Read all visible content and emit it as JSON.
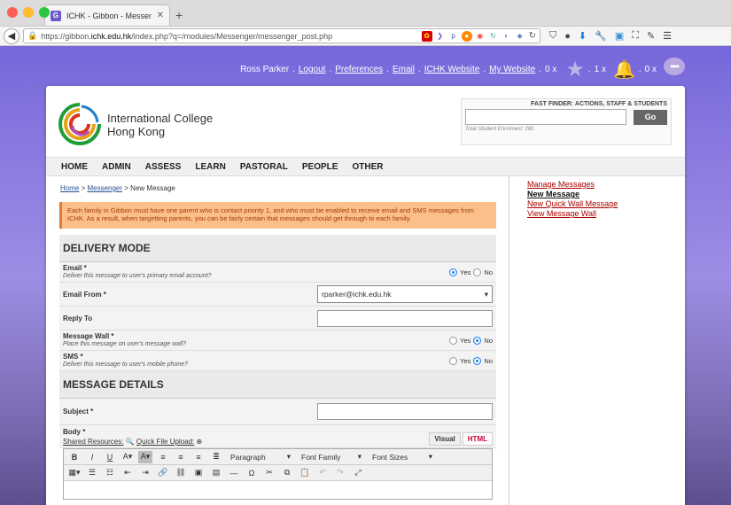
{
  "browser": {
    "tab_title": "ICHK - Gibbon - Messenger",
    "tab_favicon": "G",
    "url_prefix": "https://gibbon.",
    "url_domain": "ichk.edu.hk",
    "url_suffix": "/index.php?q=/modules/Messenger/messenger_post.php"
  },
  "toplinks": {
    "user": "Ross Parker",
    "logout": "Logout",
    "preferences": "Preferences",
    "email": "Email",
    "website": "ICHK Website",
    "my_website": "My Website",
    "likes_count": "0 x",
    "star_count": "1 x",
    "notif_count": "0 x"
  },
  "header": {
    "college_line1": "International College",
    "college_line2": "Hong Kong",
    "finder_title": "FAST FINDER: ACTIONS, STAFF & STUDENTS",
    "finder_button": "Go",
    "enrolment": "Total Student Enrolment: 280"
  },
  "menu": [
    "HOME",
    "ADMIN",
    "ASSESS",
    "LEARN",
    "PASTORAL",
    "PEOPLE",
    "OTHER"
  ],
  "breadcrumb": {
    "home": "Home",
    "messenger": "Messenger",
    "current": "New Message"
  },
  "warning": "Each family in Gibbon must have one parent who is contact priority 1, and who must be enabled to receive email and SMS messages from ICHK. As a result, when targetting parents, you can be fairly certain that messages should get through to each family.",
  "delivery": {
    "title": "DELIVERY MODE",
    "email_label": "Email *",
    "email_desc": "Deliver this message to user's primary email account?",
    "email_from_label": "Email From *",
    "email_from_value": "rparker@ichk.edu.hk",
    "reply_to_label": "Reply To",
    "wall_label": "Message Wall *",
    "wall_desc": "Place this message on user's message wall?",
    "sms_label": "SMS *",
    "sms_desc": "Deliver this message to user's mobile phone?",
    "yes": "Yes",
    "no": "No"
  },
  "details": {
    "title": "MESSAGE DETAILS",
    "subject_label": "Subject *",
    "body_label": "Body *",
    "shared_resources": "Shared Resources:",
    "quick_upload": "Quick File Upload:",
    "tab_visual": "Visual",
    "tab_html": "HTML",
    "paragraph": "Paragraph",
    "font_family": "Font Family",
    "font_sizes": "Font Sizes"
  },
  "sidebar": {
    "manage": "Manage Messages",
    "new_message": "New Message",
    "quick_wall": "New Quick Wall Message",
    "view_wall": "View Message Wall"
  }
}
